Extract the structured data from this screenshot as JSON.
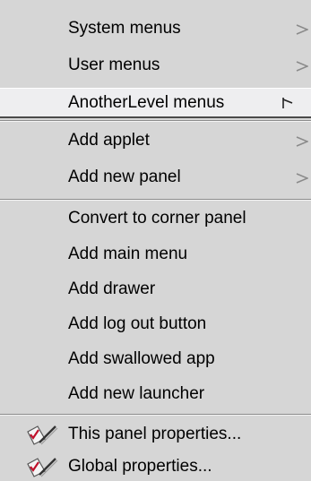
{
  "menu": {
    "items": [
      {
        "label": "System menus",
        "submenu": true
      },
      {
        "label": "User menus",
        "submenu": true
      },
      {
        "label": "AnotherLevel menus",
        "submenu": true,
        "highlighted": true
      },
      {
        "label": "Add applet",
        "submenu": true
      },
      {
        "label": "Add new panel",
        "submenu": true
      },
      {
        "label": "Convert to corner panel",
        "submenu": false
      },
      {
        "label": "Add main menu",
        "submenu": false
      },
      {
        "label": "Add drawer",
        "submenu": false
      },
      {
        "label": "Add log out button",
        "submenu": false
      },
      {
        "label": "Add swallowed app",
        "submenu": false
      },
      {
        "label": "Add new launcher",
        "submenu": false
      },
      {
        "label": "This panel properties...",
        "icon": "properties-check-icon"
      },
      {
        "label": "Global properties...",
        "icon": "properties-check-icon"
      }
    ]
  },
  "colors": {
    "menu_background": "#d6d6d6",
    "highlight_background": "#eeeef0",
    "text": "#000000"
  }
}
